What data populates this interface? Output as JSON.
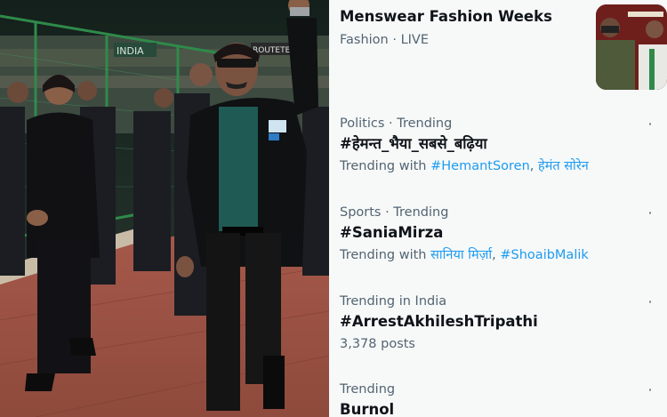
{
  "photo": {
    "banner_text": "INDIA",
    "board_text": "ROUTETE"
  },
  "event": {
    "title": "Menswear Fashion Weeks",
    "category": "Fashion",
    "separator": " · ",
    "status": "LIVE"
  },
  "trends": [
    {
      "context": "Politics · Trending",
      "headline": "#हेमन्त_भैया_सबसे_बढ़िया",
      "with_label": "Trending with ",
      "related": [
        "#HemantSoren",
        "हेमंत सोरेन"
      ]
    },
    {
      "context": "Sports · Trending",
      "headline": "#SaniaMirza",
      "with_label": "Trending with ",
      "related": [
        "सानिया मिर्ज़ा",
        "#ShoaibMalik"
      ]
    },
    {
      "context": "Trending in India",
      "headline": "#ArrestAkhileshTripathi",
      "posts": "3,378 posts"
    },
    {
      "context": "Trending",
      "headline": "Burnol"
    }
  ],
  "icons": {
    "more": "more-dots-icon"
  },
  "colors": {
    "link": "#1d9bf0",
    "secondary_text": "#536471",
    "primary_text": "#0f1419",
    "panel_bg": "#f7f9f9"
  }
}
